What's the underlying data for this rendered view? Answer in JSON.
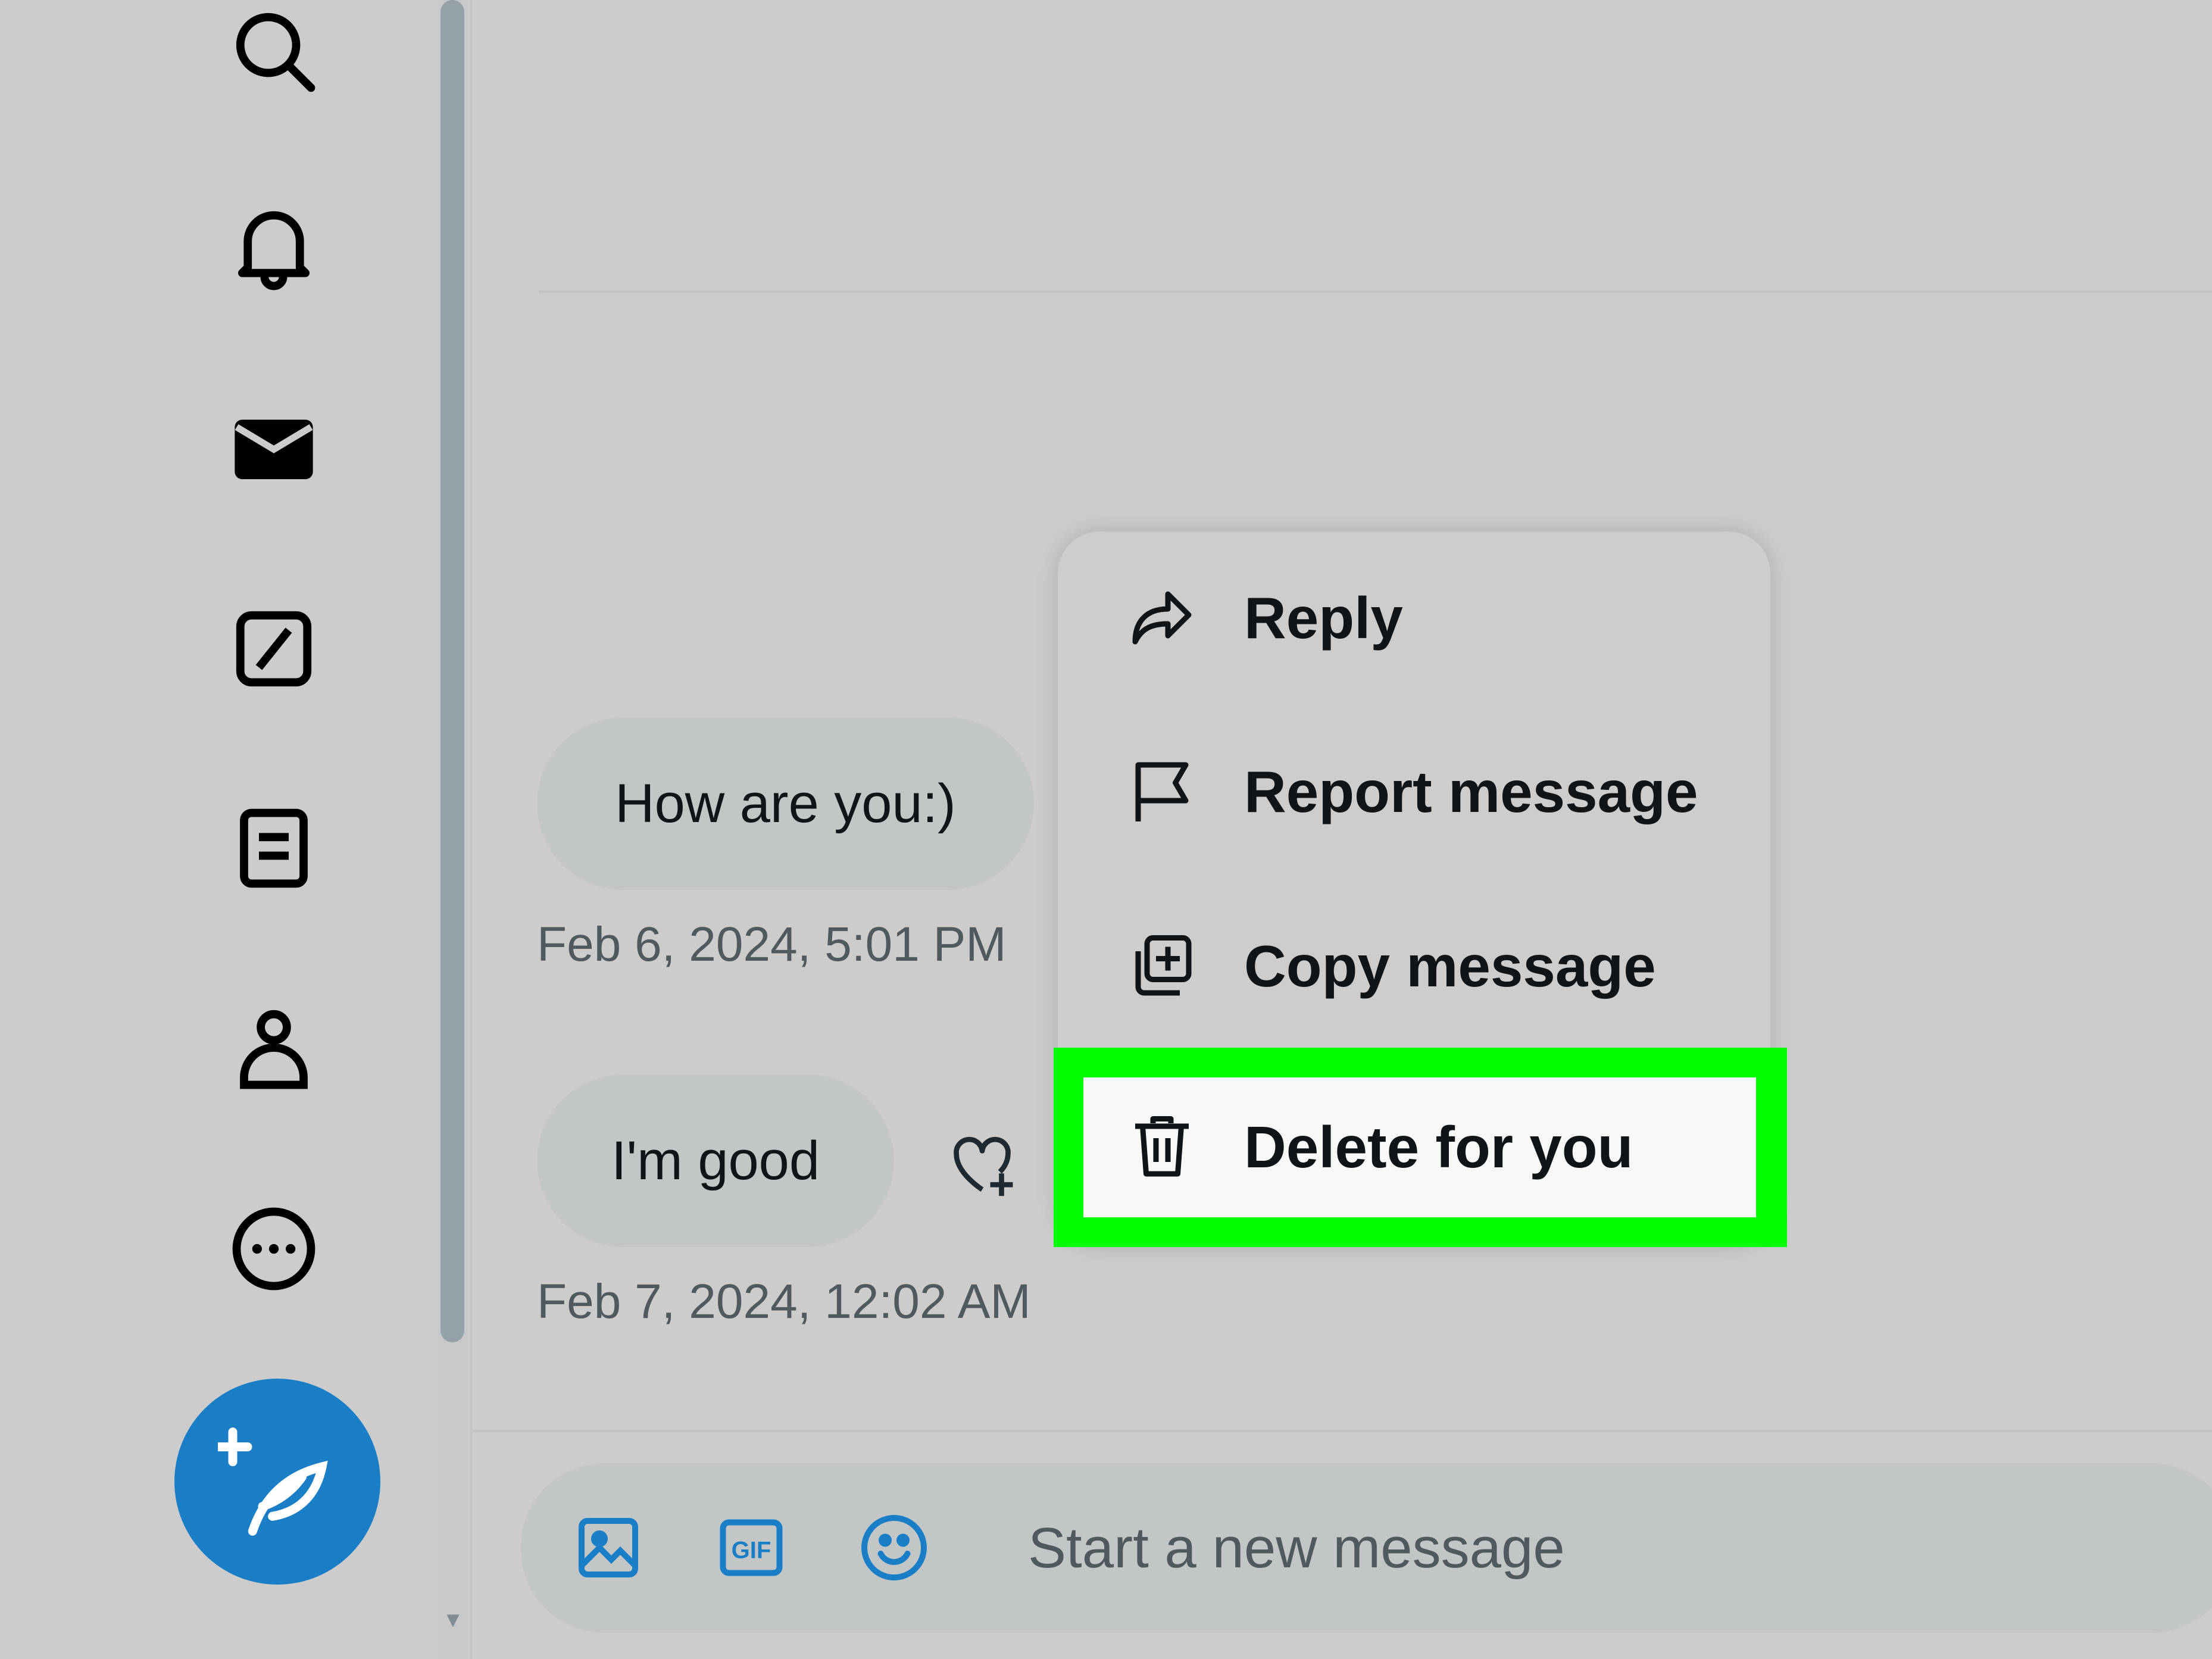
{
  "nav": {
    "icons": [
      "search-icon",
      "bell-icon",
      "mail-icon",
      "grok-icon",
      "lists-icon",
      "profile-icon",
      "more-icon"
    ],
    "compose_icon": "compose-feather-icon"
  },
  "messages": [
    {
      "text": "How are you:)",
      "time": "Feb 6, 2024, 5:01 PM"
    },
    {
      "text": "I'm good",
      "time": "Feb 7, 2024, 12:02 AM"
    }
  ],
  "context_menu": {
    "items": [
      {
        "label": "Reply",
        "icon": "reply-icon"
      },
      {
        "label": "Report message",
        "icon": "flag-icon"
      },
      {
        "label": "Copy message",
        "icon": "copy-icon"
      },
      {
        "label": "Delete for you",
        "icon": "trash-icon"
      }
    ],
    "highlighted": "Delete for you",
    "highlight_color": "#00ff00"
  },
  "composer": {
    "placeholder": "Start a new message",
    "icons": [
      "image-icon",
      "gif-icon",
      "emoji-icon"
    ],
    "gif_label": "GIF"
  },
  "colors": {
    "accent": "#1a7ec7",
    "background": "#cccccc"
  }
}
